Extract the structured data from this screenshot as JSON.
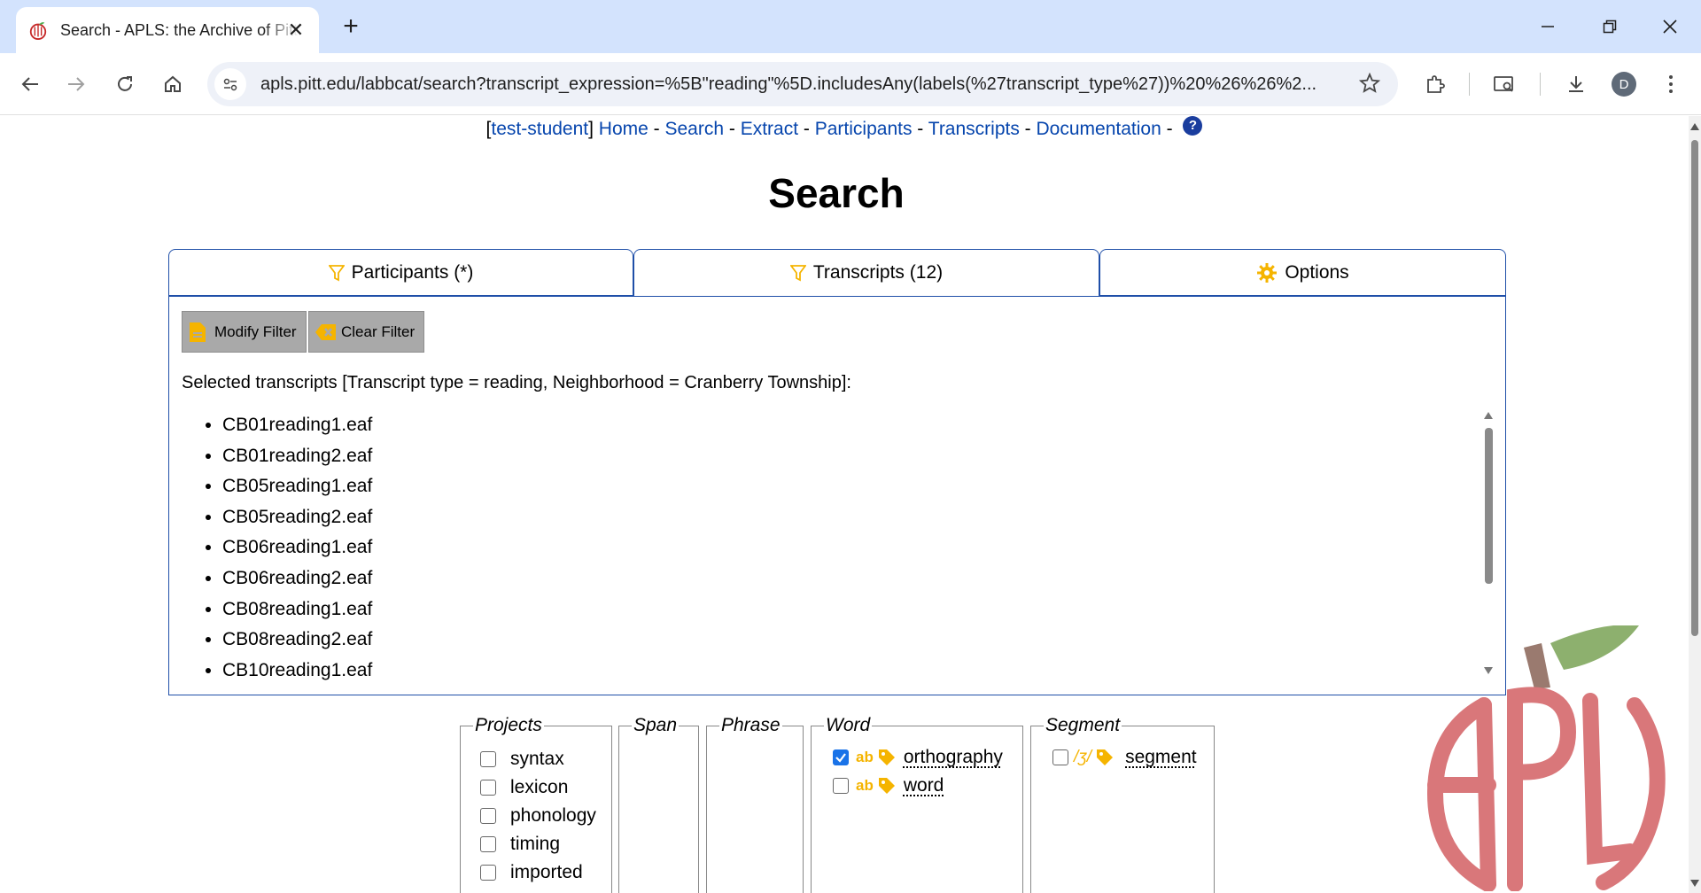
{
  "browser": {
    "tab_title": "Search - APLS: the Archive of Pittsburgh Language and Speech",
    "url": "apls.pitt.edu/labbcat/search?transcript_expression=%5B\"reading\"%5D.includesAny(labels(%27transcript_type%27))%20%26%26%2...",
    "profile_initial": "D"
  },
  "nav": {
    "user": "test-student",
    "links": [
      "Home",
      "Search",
      "Extract",
      "Participants",
      "Transcripts",
      "Documentation"
    ],
    "help": "?"
  },
  "page": {
    "title": "Search"
  },
  "tabs": [
    {
      "label": "Participants (*)",
      "icon": "filter-icon"
    },
    {
      "label": "Transcripts (12)",
      "icon": "filter-icon"
    },
    {
      "label": "Options",
      "icon": "gear-icon"
    }
  ],
  "filter": {
    "modify_label": "Modify Filter",
    "clear_label": "Clear Filter",
    "selected_text": "Selected transcripts [Transcript type = reading, Neighborhood = Cranberry Township]:",
    "transcripts": [
      "CB01reading1.eaf",
      "CB01reading2.eaf",
      "CB05reading1.eaf",
      "CB05reading2.eaf",
      "CB06reading1.eaf",
      "CB06reading2.eaf",
      "CB08reading1.eaf",
      "CB08reading2.eaf",
      "CB10reading1.eaf"
    ]
  },
  "layers": {
    "projects": {
      "legend": "Projects",
      "items": [
        "syntax",
        "lexicon",
        "phonology",
        "timing",
        "imported"
      ]
    },
    "span": {
      "legend": "Span"
    },
    "phrase": {
      "legend": "Phrase"
    },
    "word": {
      "legend": "Word",
      "items": [
        {
          "label": "orthography",
          "checked": true,
          "type_icon": "ab"
        },
        {
          "label": "word",
          "checked": false,
          "type_icon": "ab"
        }
      ]
    },
    "segment": {
      "legend": "Segment",
      "items": [
        {
          "label": "segment",
          "checked": false,
          "type_icon": "/ʒ/"
        }
      ]
    }
  },
  "colors": {
    "link": "#0645ad",
    "tab_border": "#1f4fa8",
    "accent_icon": "#f5b400",
    "logo": "#d9777a"
  }
}
